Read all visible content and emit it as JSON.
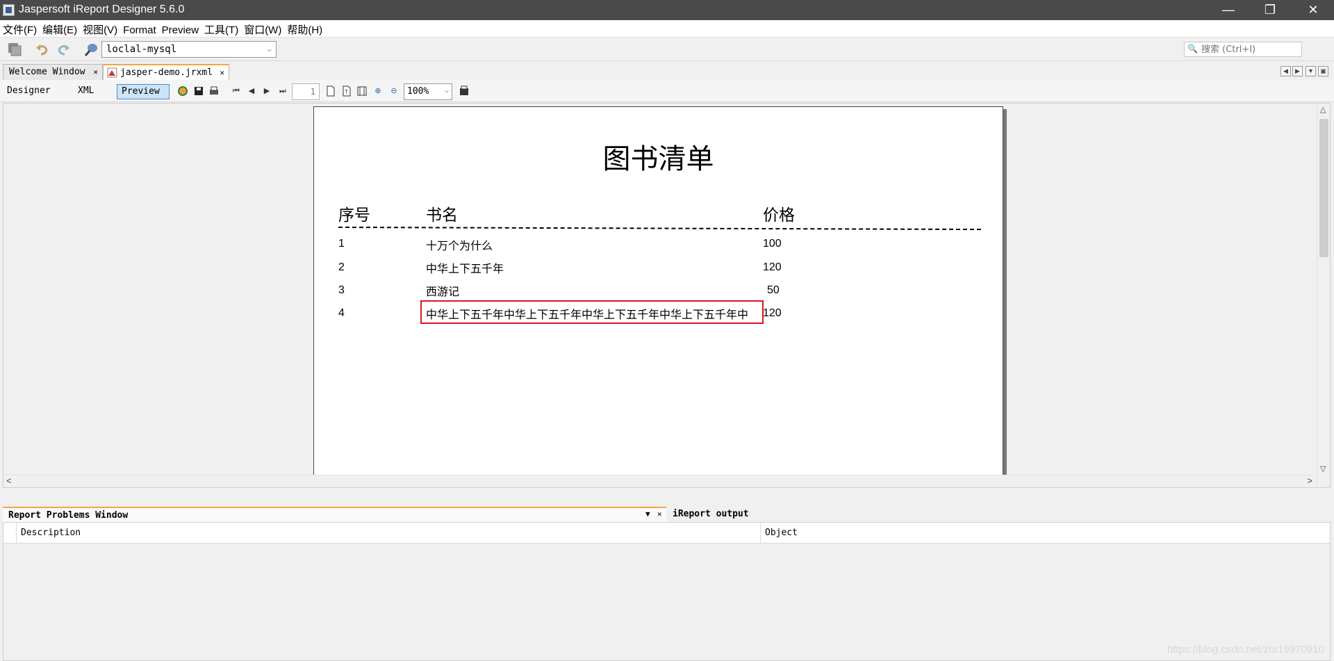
{
  "window": {
    "title": "Jaspersoft iReport Designer 5.6.0"
  },
  "menu": [
    "文件(F)",
    "编辑(E)",
    "视图(V)",
    "Format",
    "Preview",
    "工具(T)",
    "窗口(W)",
    "帮助(H)"
  ],
  "toolbar": {
    "datasource": "loclal-mysql",
    "search_placeholder": "搜索 (Ctrl+I)"
  },
  "tabs": [
    {
      "label": "Welcome Window"
    },
    {
      "label": "jasper-demo.jrxml"
    }
  ],
  "preview_toolbar": {
    "designer": "Designer",
    "xml": "XML",
    "preview": "Preview",
    "page": "1",
    "zoom": "100%"
  },
  "report": {
    "title": "图书清单",
    "headers": {
      "no": "序号",
      "name": "书名",
      "price": "价格"
    },
    "rows": [
      {
        "no": "1",
        "name": "十万个为什么",
        "price": "100"
      },
      {
        "no": "2",
        "name": "中华上下五千年",
        "price": "120"
      },
      {
        "no": "3",
        "name": "西游记",
        "price": "50"
      },
      {
        "no": "4",
        "name": "中华上下五千年中华上下五千年中华上下五千年中华上下五千年中",
        "price": "120"
      }
    ]
  },
  "bottom": {
    "tab_problems": "Report Problems Window",
    "tab_output": "iReport output",
    "col_description": "Description",
    "col_object": "Object"
  },
  "watermark": "https://blog.csdn.net/zhr19970910",
  "colors": {
    "highlight": "#e0141e",
    "tab_accent": "#f3a640",
    "titlebar": "#4a4a4a"
  }
}
